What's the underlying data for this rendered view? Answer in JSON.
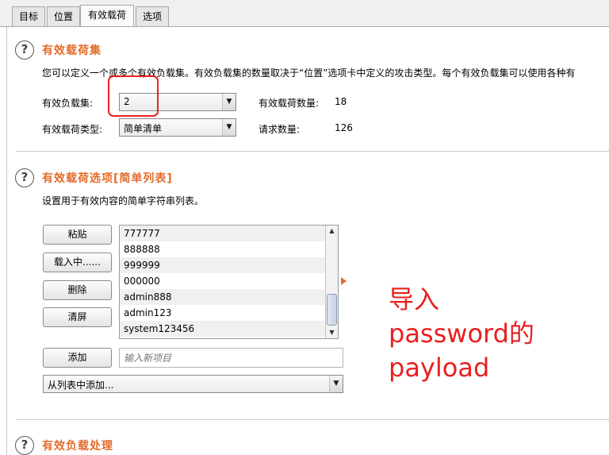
{
  "tabs": [
    {
      "label": "目标",
      "active": false
    },
    {
      "label": "位置",
      "active": false
    },
    {
      "label": "有效载荷",
      "active": true
    },
    {
      "label": "选项",
      "active": false
    }
  ],
  "payload_sets": {
    "help_icon": "?",
    "title": "有效载荷集",
    "description": "您可以定义一个或多个有效负载集。有效负载集的数量取决于“位置”选项卡中定义的攻击类型。每个有效负载集可以使用各种有",
    "set_label": "有效负载集:",
    "set_value": "2",
    "type_label": "有效载荷类型:",
    "type_value": "简单清单",
    "count_label": "有效载荷数量:",
    "count_value": "18",
    "request_label": "请求数量:",
    "request_value": "126"
  },
  "payload_options": {
    "help_icon": "?",
    "title": "有效载荷选项[简单列表]",
    "description": "设置用于有效内容的简单字符串列表。",
    "buttons": {
      "paste": "粘贴",
      "load": "载入中......",
      "remove": "删除",
      "clear": "清屏",
      "add": "添加"
    },
    "items": [
      "777777",
      "888888",
      "999999",
      "000000",
      "admin888",
      "admin123",
      "system123456"
    ],
    "new_item_placeholder": "输入新项目",
    "add_from_list": "从列表中添加..."
  },
  "payload_processing": {
    "help_icon": "?",
    "title": "有效负载处理"
  },
  "annotation": {
    "lines": [
      "导入",
      "password的",
      "payload"
    ],
    "color": "#e8201f"
  },
  "colors": {
    "accent": "#e36b2b",
    "highlight": "#ee2020"
  },
  "icons": {
    "dropdown": "▼",
    "scroll_up": "▲",
    "scroll_down": "▼"
  }
}
